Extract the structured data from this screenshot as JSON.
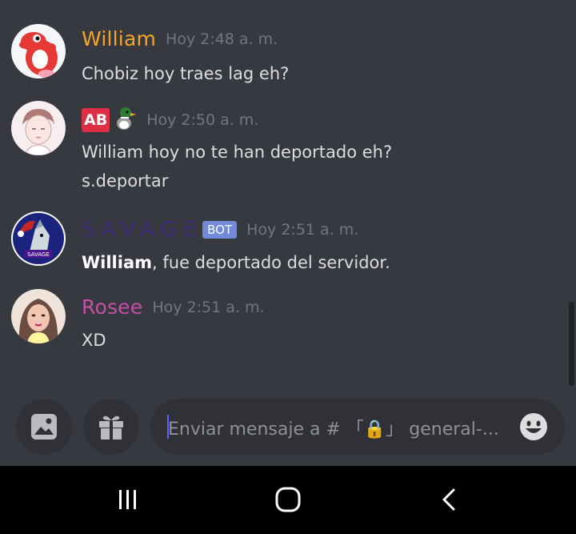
{
  "messages": [
    {
      "username": "William",
      "username_color": "#f5a623",
      "timestamp": "Hoy 2:48 a. m.",
      "lines": [
        "Chobiz hoy traes lag eh?"
      ]
    },
    {
      "username_badge": "AB",
      "timestamp": "Hoy 2:50 a. m.",
      "lines": [
        "William hoy no te han deportado eh?",
        "s.deportar"
      ]
    },
    {
      "username": "SAVAGE",
      "username_color": "#3f2a7a",
      "tag": "BOT",
      "timestamp": "Hoy 2:51 a. m.",
      "mention": "William",
      "line_rest": ", fue deportado del servidor."
    },
    {
      "username": "Rosee",
      "username_color": "#c64fa6",
      "timestamp": "Hoy 2:51 a. m.",
      "lines": [
        "XD"
      ]
    }
  ],
  "composer": {
    "placeholder": "Enviar mensaje a # 「🔒」 general-...",
    "attach_icon": "image-icon",
    "gift_icon": "gift-icon",
    "emoji_icon": "emoji-icon"
  },
  "navbar": {
    "recents_icon": "recents-icon",
    "home_icon": "home-icon",
    "back_icon": "back-icon"
  }
}
